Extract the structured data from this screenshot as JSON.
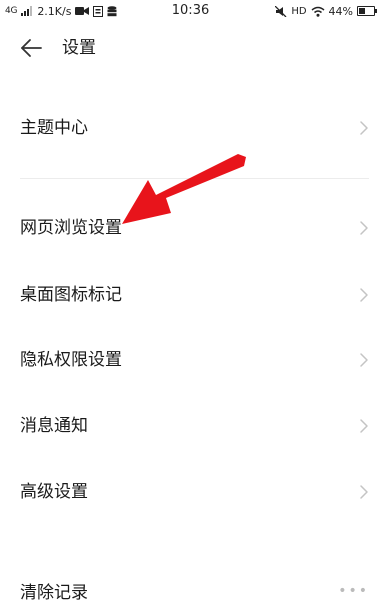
{
  "status_bar": {
    "network": "4G",
    "speed": "2.1K/s",
    "time": "10:36",
    "hd": "HD",
    "battery_text": "44%",
    "battery_level": 0.44
  },
  "header": {
    "title": "设置"
  },
  "settings_items": [
    {
      "label": "主题中心"
    },
    {
      "label": "网页浏览设置"
    },
    {
      "label": "桌面图标标记"
    },
    {
      "label": "隐私权限设置"
    },
    {
      "label": "消息通知"
    },
    {
      "label": "高级设置"
    },
    {
      "label": "清除记录"
    }
  ],
  "annotation": {
    "arrow_color": "#e8141b"
  },
  "icons": {
    "back": "arrow-left-icon",
    "chevron": "chevron-right-icon",
    "more": "more-dots-icon"
  }
}
